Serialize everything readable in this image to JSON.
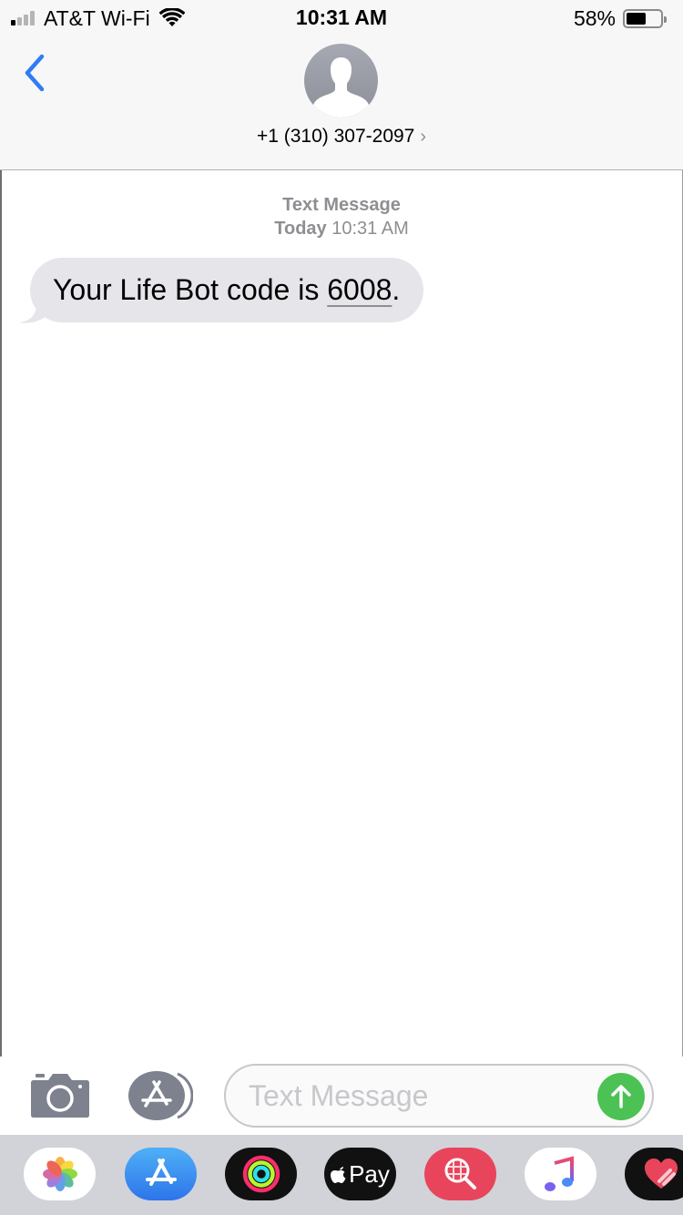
{
  "status_bar": {
    "carrier": "AT&T Wi-Fi",
    "time": "10:31 AM",
    "battery_percent_label": "58%",
    "battery_level": 0.58,
    "signal_bars_active": 1,
    "signal_bars_total": 4,
    "icons": [
      "signal-icon",
      "wifi-icon",
      "battery-icon"
    ]
  },
  "header": {
    "back_icon": "chevron-left-icon",
    "avatar_icon": "person-silhouette-icon",
    "contact": "+1 (310) 307-2097",
    "contact_chevron": "›"
  },
  "thread": {
    "service": "Text Message",
    "day": "Today",
    "time": "10:31 AM",
    "messages": [
      {
        "direction": "incoming",
        "text_before": "Your Life Bot code is ",
        "code": "6008",
        "text_after": "."
      }
    ]
  },
  "input_bar": {
    "camera_icon": "camera-icon",
    "apps_icon": "app-store-icon",
    "placeholder": "Text Message",
    "value": "",
    "send_icon": "arrow-up-icon"
  },
  "app_drawer": {
    "apps": [
      {
        "name": "Photos",
        "icon": "photos-icon"
      },
      {
        "name": "App Store",
        "icon": "app-store-icon"
      },
      {
        "name": "Activity",
        "icon": "activity-rings-icon"
      },
      {
        "name": "Apple Pay",
        "icon": "apple-pay-icon",
        "label": "Pay"
      },
      {
        "name": "Web Search",
        "icon": "globe-search-icon"
      },
      {
        "name": "Music",
        "icon": "music-note-icon"
      },
      {
        "name": "Digital Touch",
        "icon": "heart-icon"
      }
    ]
  },
  "colors": {
    "accent_blue": "#2f7cf6",
    "send_green": "#4cc254",
    "bubble_gray": "#e5e5ea",
    "meta_gray": "#8e8e93"
  }
}
